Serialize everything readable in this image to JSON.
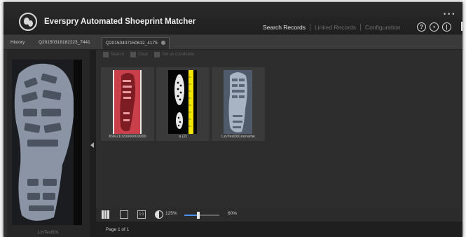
{
  "app": {
    "title": "Everspry Automated Shoeprint Matcher",
    "nav": [
      {
        "label": "Search Records",
        "active": true
      },
      {
        "label": "Linked Records",
        "active": false
      },
      {
        "label": "Configuration",
        "active": false
      }
    ],
    "header_icons": [
      "help-icon",
      "user-icon",
      "power-icon"
    ]
  },
  "tabs": {
    "history": "History",
    "items": [
      "Q20150318182223_7441",
      "Q20150407150612_4175"
    ]
  },
  "toolbar": [
    "Search",
    "Clear",
    "Set as Candidate"
  ],
  "left_panel": {
    "preview_label": "LzvTest001"
  },
  "results": [
    {
      "caption": "K9K21020000000000",
      "kind": "red-shoeprint"
    },
    {
      "caption": "a (2)",
      "kind": "dark-print-with-ruler"
    },
    {
      "caption": "LzvTest001noname",
      "kind": "gray-shoeprint"
    }
  ],
  "bottombar": {
    "zoom": "125%",
    "opacity": "60%"
  },
  "pagination": {
    "text": "Page 1 of 1"
  },
  "colors": {
    "accent": "#4a8ef0",
    "background": "#2d2d2d",
    "ruler": "#f2e600"
  }
}
